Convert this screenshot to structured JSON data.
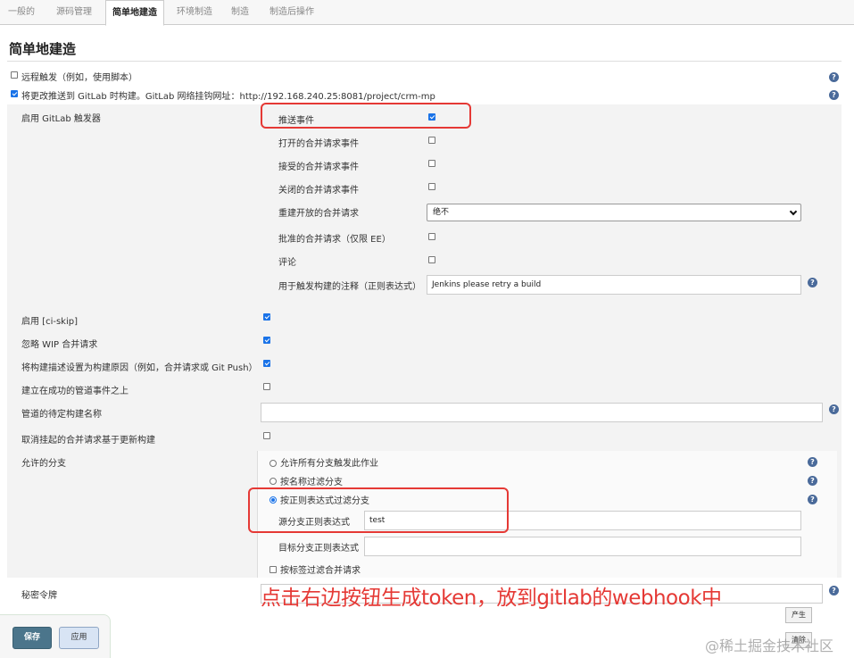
{
  "tabs": [
    "一般的",
    "源码管理",
    "简单地建造",
    "环境制造",
    "制造",
    "制造后操作"
  ],
  "section_title": "简单地建造",
  "remote_trigger": {
    "label": "远程触发（例如，使用脚本）",
    "checked": false
  },
  "gitlab_push": {
    "label": "将更改推送到 GitLab 时构建。GitLab 网络挂钩网址：http://192.168.240.25:8081/project/crm-mp",
    "checked": true
  },
  "trigger_label": "启用 GitLab 触发器",
  "triggers": {
    "push": {
      "label": "推送事件",
      "checked": true
    },
    "open_mr": {
      "label": "打开的合并请求事件",
      "checked": false
    },
    "accepted_mr": {
      "label": "接受的合并请求事件",
      "checked": false
    },
    "closed_mr": {
      "label": "关闭的合并请求事件",
      "checked": false
    },
    "rebuild_open": {
      "label": "重建开放的合并请求",
      "value": "绝不"
    },
    "approved_mr": {
      "label": "批准的合并请求（仅限 EE）",
      "checked": false
    },
    "comments": {
      "label": "评论",
      "checked": false
    },
    "comment_regex": {
      "label": "用于触发构建的注释（正则表达式）",
      "value": "Jenkins please retry a build"
    }
  },
  "options": {
    "ci_skip": {
      "label": "启用 [ci-skip]",
      "checked": true
    },
    "ignore_wip": {
      "label": "忽略 WIP 合并请求",
      "checked": true
    },
    "set_description": {
      "label": "将构建描述设置为构建原因（例如，合并请求或 Git Push）",
      "checked": true
    },
    "pipeline_success": {
      "label": "建立在成功的管道事件之上",
      "checked": false
    },
    "pending_build_name": {
      "label": "管道的待定构建名称",
      "value": ""
    },
    "cancel_pending": {
      "label": "取消挂起的合并请求基于更新构建",
      "checked": false
    }
  },
  "branches": {
    "label": "允许的分支",
    "all": "允许所有分支触发此作业",
    "by_name": "按名称过滤分支",
    "by_regex": "按正则表达式过滤分支",
    "source_regex_label": "源分支正则表达式",
    "source_regex_value": "test",
    "target_regex_label": "目标分支正则表达式",
    "target_regex_value": "",
    "by_label": "按标签过滤合并请求",
    "selected": "by_regex"
  },
  "secret_token": {
    "label": "秘密令牌",
    "value": ""
  },
  "generate_label": "产生",
  "clear_label": "清除",
  "annotation": "点击右边按钮生成token，放到gitlab的webhook中",
  "save_label": "保存",
  "apply_label": "应用",
  "watermark": "@稀土掘金技术社区",
  "help_glyph": "?",
  "colors": {
    "annotation_red": "#e53935",
    "checkbox_blue": "#1a73e8",
    "save_button": "#4b758b"
  }
}
